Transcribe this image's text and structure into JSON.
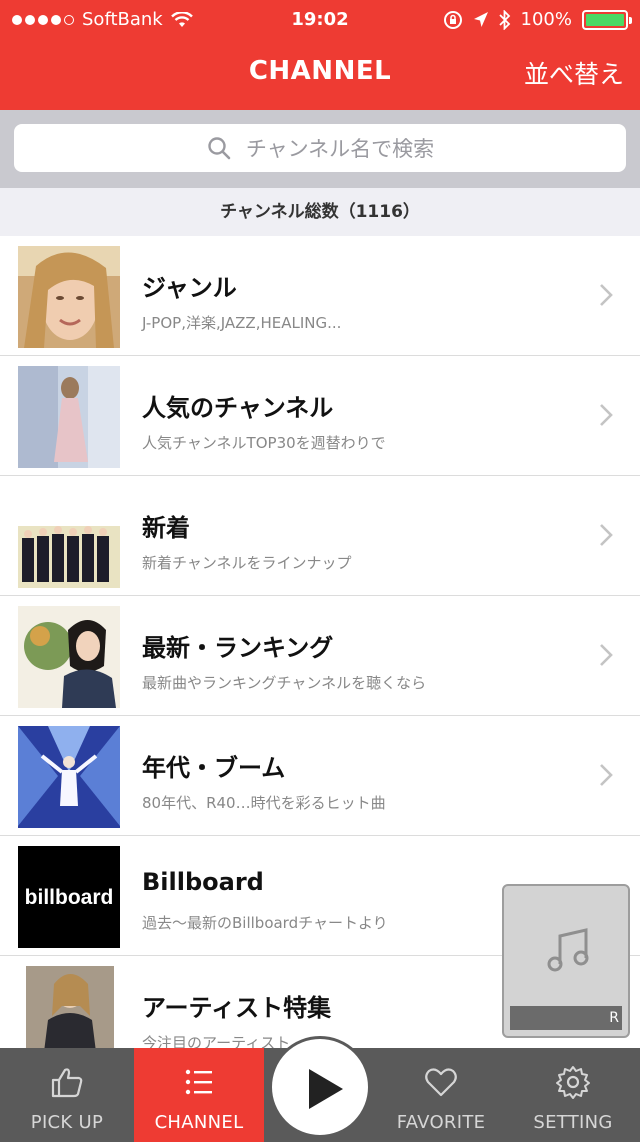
{
  "status_bar": {
    "carrier": "SoftBank",
    "time": "19:02",
    "battery": "100%"
  },
  "nav": {
    "title": "CHANNEL",
    "sort_label": "並べ替え"
  },
  "search": {
    "placeholder": "チャンネル名で検索"
  },
  "count_text": "チャンネル総数（1116）",
  "list": [
    {
      "title": "ジャンル",
      "subtitle": "J-POP,洋楽,JAZZ,HEALING..."
    },
    {
      "title": "人気のチャンネル",
      "subtitle": "人気チャンネルTOP30を週替わりで"
    },
    {
      "title": "新着",
      "subtitle": "新着チャンネルをラインナップ"
    },
    {
      "title": "最新・ランキング",
      "subtitle": "最新曲やランキングチャンネルを聴くなら"
    },
    {
      "title": "年代・ブーム",
      "subtitle": "80年代、R40…時代を彩るヒット曲"
    },
    {
      "title": "Billboard",
      "subtitle": "過去～最新のBillboardチャートより",
      "logo_text": "billboard"
    },
    {
      "title": "アーティスト特集",
      "subtitle": "今注目のアーティスト"
    }
  ],
  "mini_player": {
    "icon": "music-note-icon",
    "label": "R"
  },
  "tabs": [
    {
      "label": "PICK UP",
      "icon": "thumbs-up-icon"
    },
    {
      "label": "CHANNEL",
      "icon": "list-icon"
    },
    {
      "label": "FAVORITE",
      "icon": "heart-icon"
    },
    {
      "label": "SETTING",
      "icon": "gear-icon"
    }
  ],
  "colors": {
    "brand": "#ee3b33",
    "tabbar": "#5a5a5a",
    "battery": "#4cd964"
  }
}
